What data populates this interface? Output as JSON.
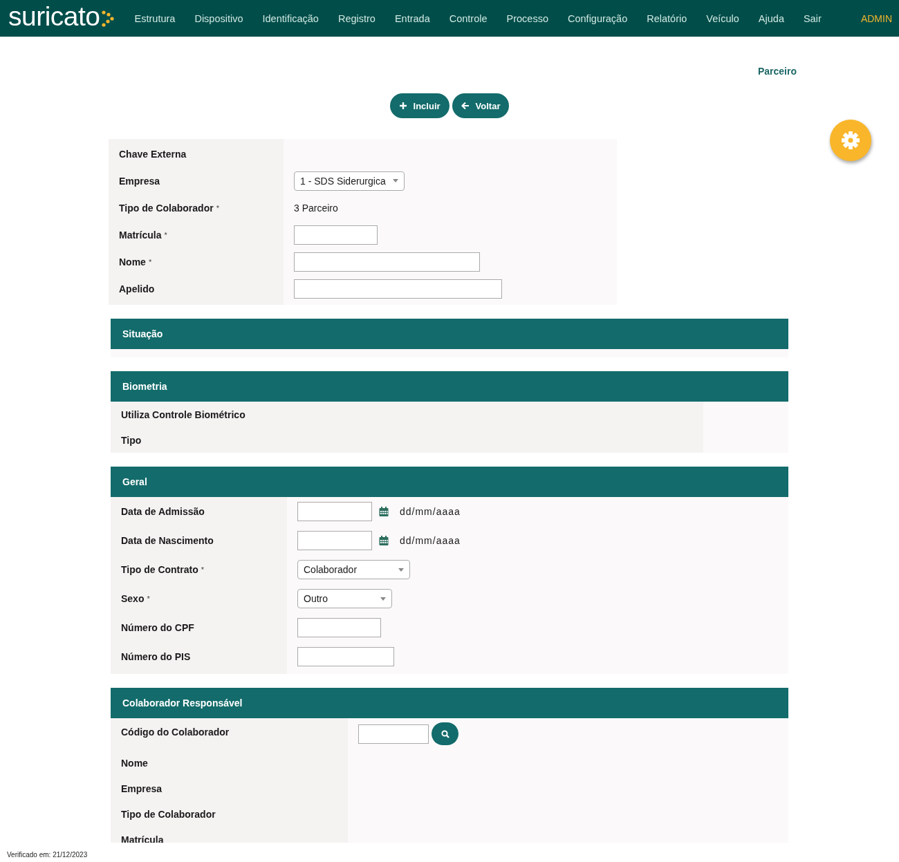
{
  "header": {
    "logo": "suricato",
    "nav": [
      {
        "label": "Estrutura"
      },
      {
        "label": "Dispositivo"
      },
      {
        "label": "Identificação"
      },
      {
        "label": "Registro"
      },
      {
        "label": "Entrada"
      },
      {
        "label": "Controle"
      },
      {
        "label": "Processo"
      },
      {
        "label": "Configuração"
      },
      {
        "label": "Relatório"
      },
      {
        "label": "Veículo"
      },
      {
        "label": "Ajuda"
      },
      {
        "label": "Sair"
      }
    ],
    "user": "ADMIN"
  },
  "page_title": "Parceiro",
  "actions": [
    {
      "label": "Incluir",
      "kind": "add"
    },
    {
      "label": "Voltar",
      "kind": "back"
    }
  ],
  "main_form": {
    "rows": [
      {
        "label": "Chave Externa",
        "kind": "empty"
      },
      {
        "label": "Empresa",
        "kind": "select",
        "value": "1 - SDS Siderurgica"
      },
      {
        "label": "Tipo de Colaborador",
        "mark": "*",
        "kind": "text",
        "value": "3 Parceiro"
      },
      {
        "label": "Matrícula",
        "mark": "*",
        "kind": "input"
      },
      {
        "label": "Nome",
        "mark": "*",
        "kind": "input"
      },
      {
        "label": "Apelido",
        "kind": "input"
      }
    ]
  },
  "sections": [
    {
      "title": "Situação"
    },
    {
      "title": "Biometria",
      "rows": [
        {
          "label": "Utiliza Controle Biométrico",
          "kind": "empty"
        },
        {
          "label": "Tipo",
          "kind": "empty"
        }
      ]
    },
    {
      "title": "Geral",
      "rows": [
        {
          "label": "Data de Admissão",
          "kind": "date",
          "hint": "dd/mm/aaaa"
        },
        {
          "label": "Data de Nascimento",
          "kind": "date",
          "hint": "dd/mm/aaaa"
        },
        {
          "label": "Tipo de Contrato",
          "mark": "*",
          "kind": "select",
          "value": "Colaborador"
        },
        {
          "label": "Sexo",
          "mark": "*",
          "kind": "select",
          "value": "Outro"
        },
        {
          "label": "Número do CPF",
          "kind": "input"
        },
        {
          "label": "Número do PIS",
          "kind": "input"
        }
      ]
    },
    {
      "title": "Colaborador Responsável",
      "rows": [
        {
          "label": "Código do Colaborador",
          "kind": "search"
        },
        {
          "label": "Nome",
          "kind": "empty"
        },
        {
          "label": "Empresa",
          "kind": "empty"
        },
        {
          "label": "Tipo de Colaborador",
          "kind": "empty"
        },
        {
          "label": "Matrícula",
          "kind": "empty"
        }
      ]
    }
  ],
  "footer": "Verificado em: 21/12/2023"
}
